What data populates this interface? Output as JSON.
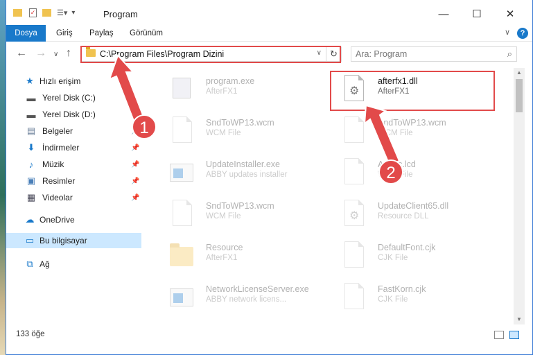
{
  "window": {
    "title": "Program"
  },
  "ribbon": {
    "tabs": [
      "Dosya",
      "Giriş",
      "Paylaş",
      "Görünüm"
    ],
    "help": "?"
  },
  "navigation": {
    "address": "C:\\Program Files\\Program Dizini",
    "search_placeholder": "Ara: Program"
  },
  "sidebar": {
    "items": [
      {
        "label": "Hızlı erişim",
        "icon": "star-icon"
      },
      {
        "label": "Yerel Disk (C:)",
        "icon": "drive-icon"
      },
      {
        "label": "Yerel Disk (D:)",
        "icon": "drive-icon"
      },
      {
        "label": "Belgeler",
        "icon": "documents-icon"
      },
      {
        "label": "İndirmeler",
        "icon": "download-icon"
      },
      {
        "label": "Müzik",
        "icon": "music-icon"
      },
      {
        "label": "Resimler",
        "icon": "pictures-icon"
      },
      {
        "label": "Videolar",
        "icon": "video-icon"
      },
      {
        "label": "OneDrive",
        "icon": "cloud-icon"
      },
      {
        "label": "Bu bilgisayar",
        "icon": "computer-icon"
      },
      {
        "label": "Ağ",
        "icon": "network-icon"
      }
    ]
  },
  "files": [
    {
      "name": "program.exe",
      "sub": "AfterFX1",
      "icon": "exe-icon"
    },
    {
      "name": "afterfx1.dll",
      "sub": "AfterFX1",
      "icon": "dll-icon"
    },
    {
      "name": "SndToWP13.wcm",
      "sub": "WCM File",
      "icon": "file-icon"
    },
    {
      "name": "SndToWP13.wcm",
      "sub": "WCM File",
      "icon": "file-icon"
    },
    {
      "name": "UpdateInstaller.exe",
      "sub": "ABBY updates installer",
      "icon": "app-icon"
    },
    {
      "name": "Arabic.lcd",
      "sub": "WCM File",
      "icon": "file-icon"
    },
    {
      "name": "SndToWP13.wcm",
      "sub": "WCM File",
      "icon": "file-icon"
    },
    {
      "name": "UpdateClient65.dll",
      "sub": "Resource DLL",
      "icon": "dll-icon"
    },
    {
      "name": "Resource",
      "sub": "AfterFX1",
      "icon": "folder-icon"
    },
    {
      "name": "DefaultFont.cjk",
      "sub": "CJK File",
      "icon": "file-icon"
    },
    {
      "name": "NetworkLicenseServer.exe",
      "sub": "ABBY network licens...",
      "icon": "app-icon"
    },
    {
      "name": "FastKorn.cjk",
      "sub": "CJK File",
      "icon": "file-icon"
    }
  ],
  "status": {
    "count": "133 öğe"
  },
  "annotations": {
    "badge1": "1",
    "badge2": "2",
    "color": "#e24a4a"
  }
}
